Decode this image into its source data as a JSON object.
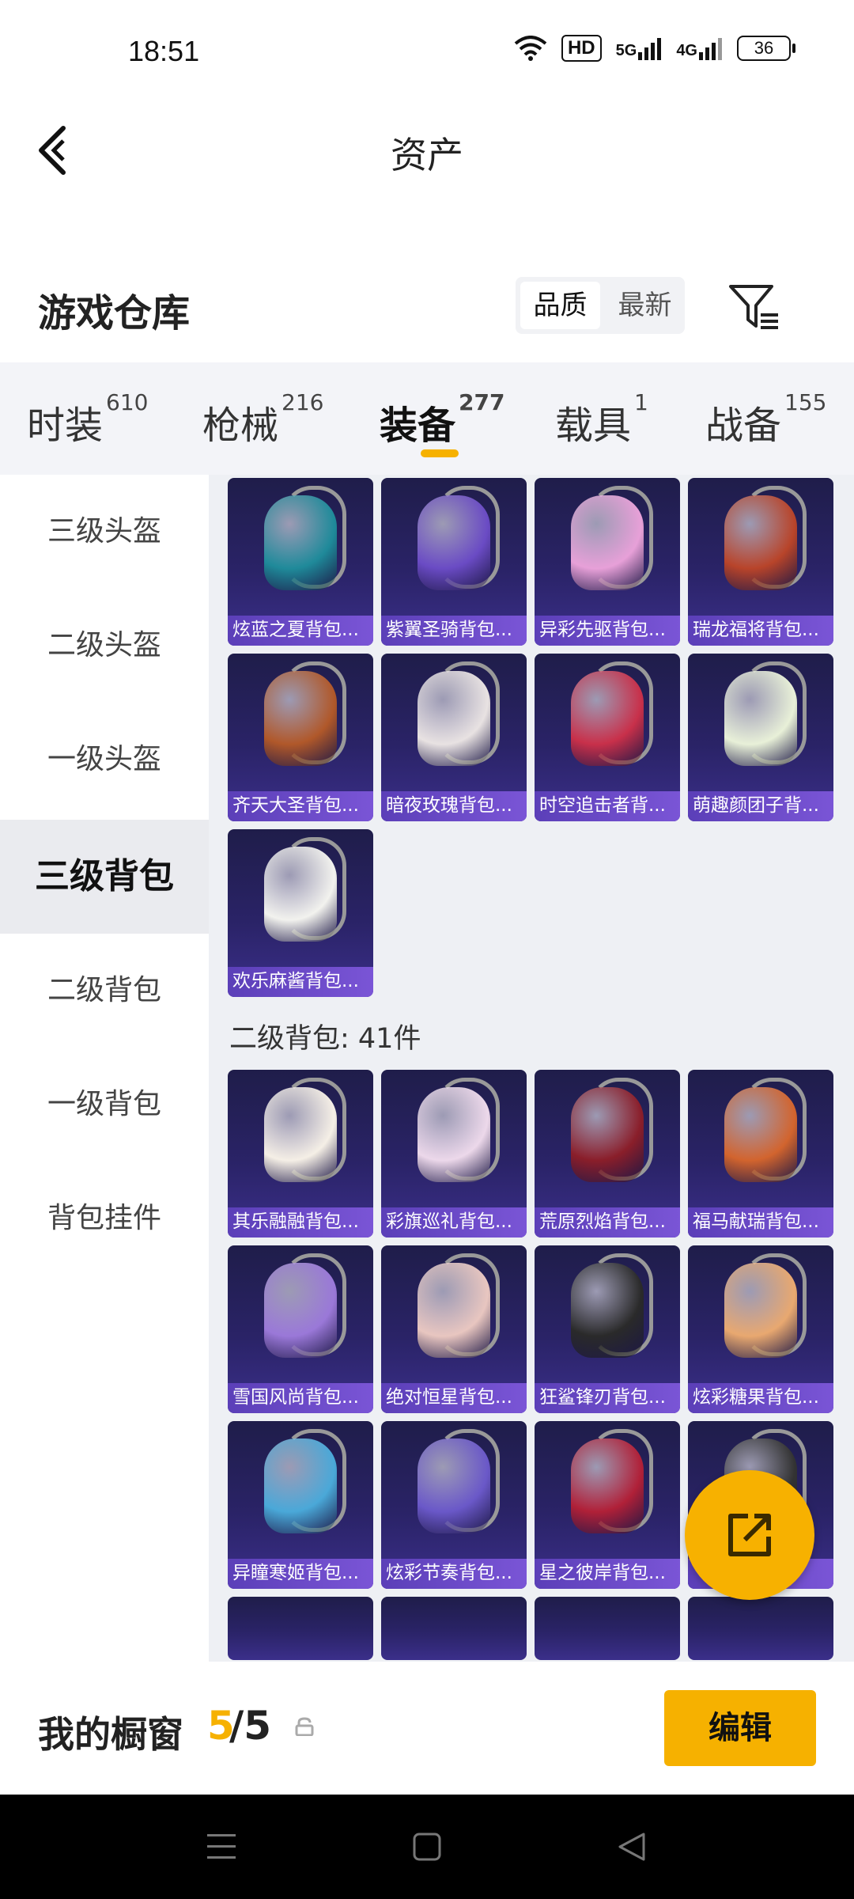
{
  "status_bar": {
    "time": "18:51",
    "hd": "HD",
    "net1": "5G",
    "net2": "4G",
    "battery": "36"
  },
  "header": {
    "title": "资产"
  },
  "warehouse": {
    "title": "游戏仓库",
    "sort_quality": "品质",
    "sort_latest": "最新"
  },
  "tabs": [
    {
      "label": "时装",
      "count": "610"
    },
    {
      "label": "枪械",
      "count": "216"
    },
    {
      "label": "装备",
      "count": "277"
    },
    {
      "label": "载具",
      "count": "1"
    },
    {
      "label": "战备",
      "count": "155"
    }
  ],
  "sidebar": [
    {
      "label": "三级头盔"
    },
    {
      "label": "二级头盔"
    },
    {
      "label": "一级头盔"
    },
    {
      "label": "三级背包"
    },
    {
      "label": "二级背包"
    },
    {
      "label": "一级背包"
    },
    {
      "label": "背包挂件"
    }
  ],
  "level3_items": [
    {
      "name": "炫蓝之夏背包...",
      "color": "#1f8a9a"
    },
    {
      "name": "紫翼圣骑背包...",
      "color": "#6a4bc4"
    },
    {
      "name": "异彩先驱背包...",
      "color": "#e7a0d8"
    },
    {
      "name": "瑞龙福将背包...",
      "color": "#b8442a"
    },
    {
      "name": "齐天大圣背包...",
      "color": "#b0582a"
    },
    {
      "name": "暗夜玫瑰背包...",
      "color": "#e8e2e2"
    },
    {
      "name": "时空追击者背...",
      "color": "#c8304a"
    },
    {
      "name": "萌趣颜团子背...",
      "color": "#e8f0d8"
    },
    {
      "name": "欢乐麻酱背包...",
      "color": "#f2f2ee"
    }
  ],
  "level2_section": {
    "label": "二级背包: 41件"
  },
  "level2_items": [
    {
      "name": "其乐融融背包...",
      "color": "#f5efe6"
    },
    {
      "name": "彩旗巡礼背包...",
      "color": "#ecd8ea"
    },
    {
      "name": "荒原烈焰背包...",
      "color": "#8a1e2a"
    },
    {
      "name": "福马献瑞背包...",
      "color": "#d2642e"
    },
    {
      "name": "雪国风尚背包...",
      "color": "#9a78d8"
    },
    {
      "name": "绝对恒星背包...",
      "color": "#e8c6c0"
    },
    {
      "name": "狂鲨锋刃背包...",
      "color": "#2a2a2a"
    },
    {
      "name": "炫彩糖果背包...",
      "color": "#e8a870"
    },
    {
      "name": "异瞳寒姬背包...",
      "color": "#4aa8d8"
    },
    {
      "name": "炫彩节奏背包...",
      "color": "#6a58c8"
    },
    {
      "name": "星之彼岸背包...",
      "color": "#b02038"
    },
    {
      "name": "",
      "color": "#333333"
    }
  ],
  "showcase": {
    "title": "我的橱窗",
    "count": "5",
    "total": "/5",
    "edit_label": "编辑"
  }
}
